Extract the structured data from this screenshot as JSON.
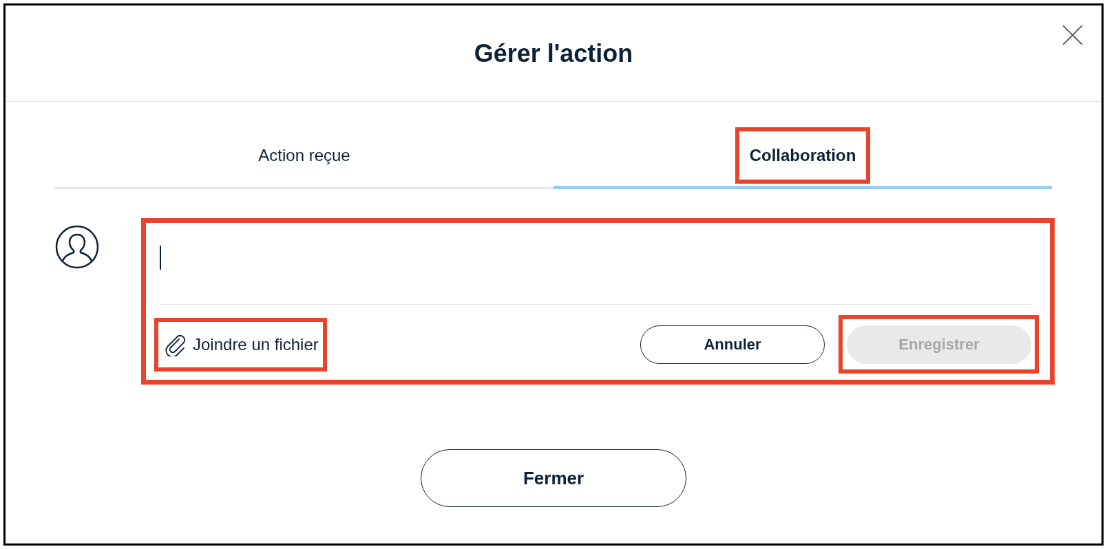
{
  "dialog": {
    "title": "Gérer l'action"
  },
  "tabs": [
    {
      "label": "Action reçue",
      "selected": false,
      "highlighted": false
    },
    {
      "label": "Collaboration",
      "selected": true,
      "highlighted": true
    }
  ],
  "comment": {
    "focused": true,
    "highlighted": true,
    "attach_link": {
      "label": "Joindre un fichier",
      "highlighted": true
    },
    "buttons": [
      {
        "label": "Annuler",
        "disabled": false,
        "highlighted": false
      },
      {
        "label": "Enregistrer",
        "disabled": true,
        "highlighted": true
      }
    ]
  },
  "footer_button": {
    "label": "Fermer"
  }
}
